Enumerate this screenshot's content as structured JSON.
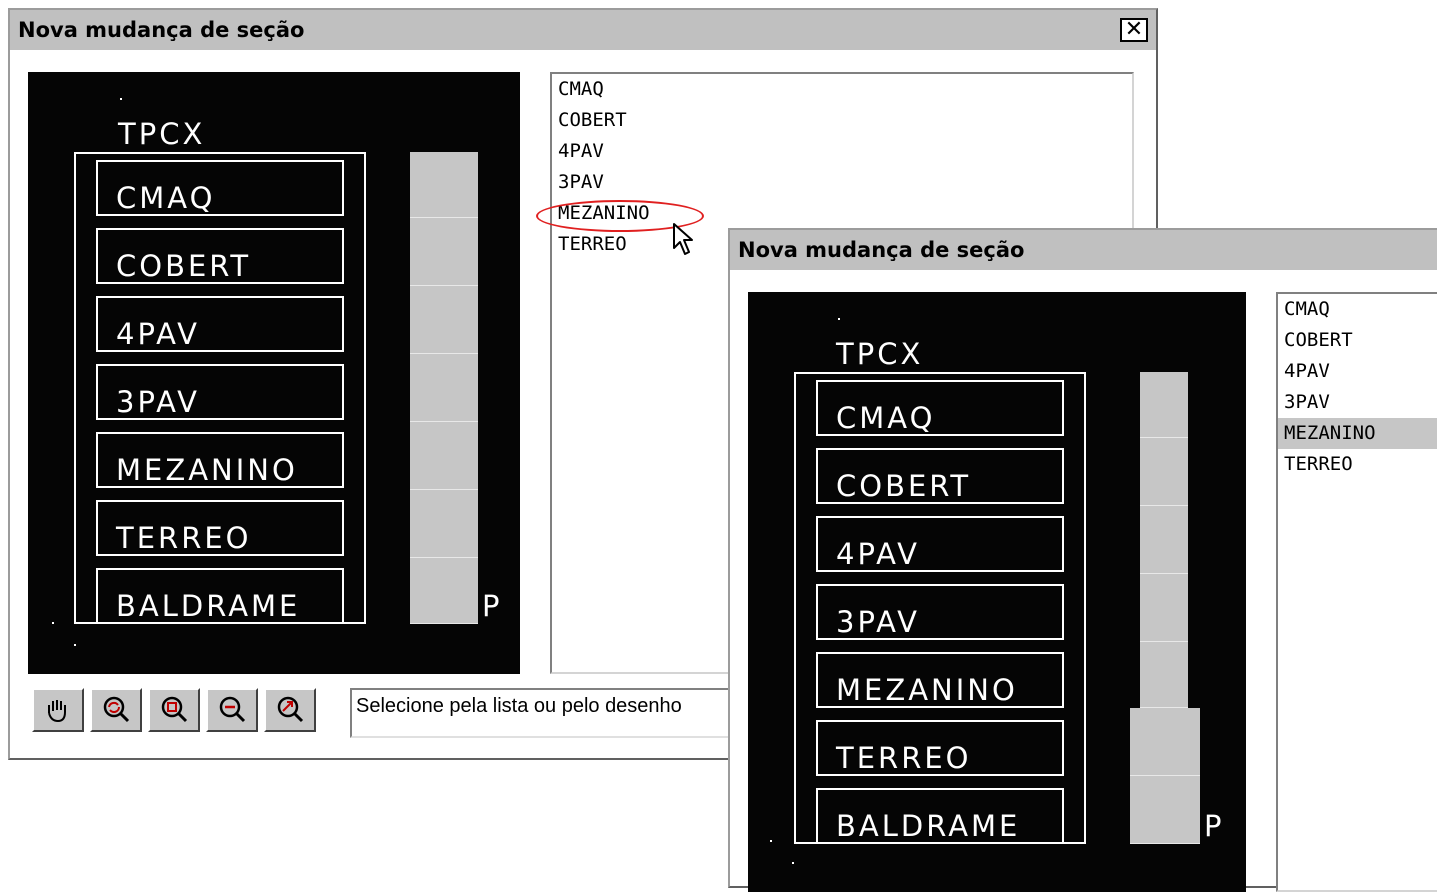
{
  "colors": {
    "canvas_bg": "#050505",
    "cad_line": "#ffffff",
    "bar_fill": "#c6c6c6",
    "title_bg": "#c0c0c0",
    "highlight": "#e02020"
  },
  "dialog1": {
    "title": "Nova mudança de seção",
    "close_label": "✕",
    "drawing": {
      "building_name": "TPCX",
      "floors": [
        "CMAQ",
        "COBERT",
        "4PAV",
        "3PAV",
        "MEZANINO",
        "TERREO",
        "BALDRAME"
      ],
      "bar_marker": "P"
    },
    "list_items": [
      "CMAQ",
      "COBERT",
      "4PAV",
      "3PAV",
      "MEZANINO",
      "TERREO"
    ],
    "highlighted_item": "MEZANINO",
    "toolbar_icons": [
      "pan-hand-icon",
      "zoom-refresh-icon",
      "zoom-window-icon",
      "zoom-out-icon",
      "zoom-extents-icon"
    ],
    "status_text": "Selecione pela lista ou pelo desenho"
  },
  "dialog2": {
    "title": "Nova mudança de seção",
    "drawing": {
      "building_name": "TPCX",
      "floors": [
        "CMAQ",
        "COBERT",
        "4PAV",
        "3PAV",
        "MEZANINO",
        "TERREO",
        "BALDRAME"
      ],
      "bar_marker": "P"
    },
    "list_items": [
      "CMAQ",
      "COBERT",
      "4PAV",
      "3PAV",
      "MEZANINO",
      "TERREO"
    ],
    "selected_item": "MEZANINO"
  }
}
